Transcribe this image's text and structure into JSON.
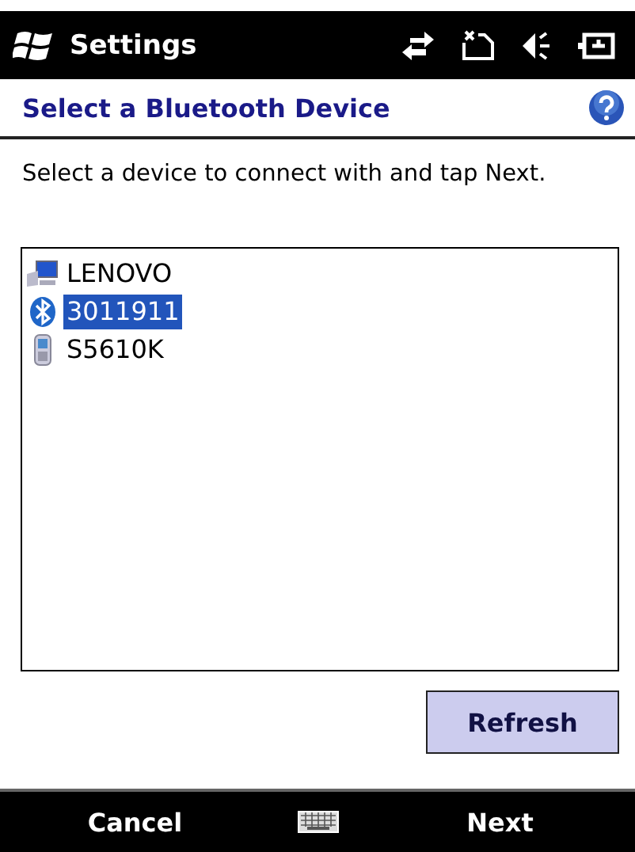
{
  "title_bar": {
    "title": "Settings"
  },
  "header": {
    "title": "Select a Bluetooth Device"
  },
  "instruction": "Select a device to connect with and tap Next.",
  "devices": [
    {
      "name": "LENOVO",
      "kind": "computer",
      "selected": false
    },
    {
      "name": "3011911",
      "kind": "bluetooth",
      "selected": true
    },
    {
      "name": "S5610K",
      "kind": "phone",
      "selected": false
    }
  ],
  "refresh_button": "Refresh",
  "softkeys": {
    "left": "Cancel",
    "right": "Next"
  }
}
